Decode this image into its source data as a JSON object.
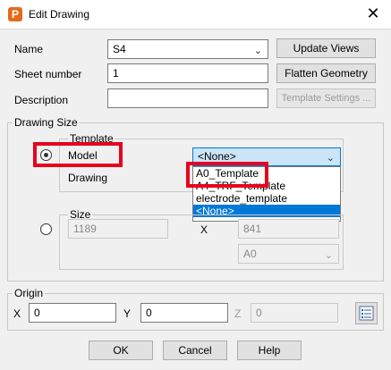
{
  "window": {
    "app_icon_letter": "P",
    "title": "Edit Drawing",
    "close_glyph": "✕"
  },
  "fields": {
    "name_label": "Name",
    "name_value": "S4",
    "sheet_label": "Sheet number",
    "sheet_value": "1",
    "description_label": "Description",
    "description_value": ""
  },
  "buttons": {
    "update_views": "Update Views",
    "flatten_geometry": "Flatten Geometry",
    "template_settings": "Template Settings ...",
    "ok": "OK",
    "cancel": "Cancel",
    "help": "Help"
  },
  "drawing_size": {
    "group_label": "Drawing Size",
    "template_label": "Template",
    "model_label": "Model",
    "drawing_label": "Drawing",
    "template_selected": "<None>",
    "template_options": [
      "A0_Template",
      "A4_TRF_Template",
      "electrode_template",
      "<None>"
    ],
    "size_label": "Size",
    "width_value": "1189",
    "x_label": "X",
    "height_value": "841",
    "paper_value": "A0"
  },
  "origin": {
    "group_label": "Origin",
    "x_label": "X",
    "x_value": "0",
    "y_label": "Y",
    "y_value": "0",
    "z_label": "Z",
    "z_value": "0"
  },
  "icons": {
    "chevron": "chevron-down-icon",
    "list": "list-icon",
    "close": "close-icon"
  },
  "colors": {
    "highlight": "#e8001c",
    "selection": "#0078d7",
    "app_icon": "#e46b1c"
  }
}
